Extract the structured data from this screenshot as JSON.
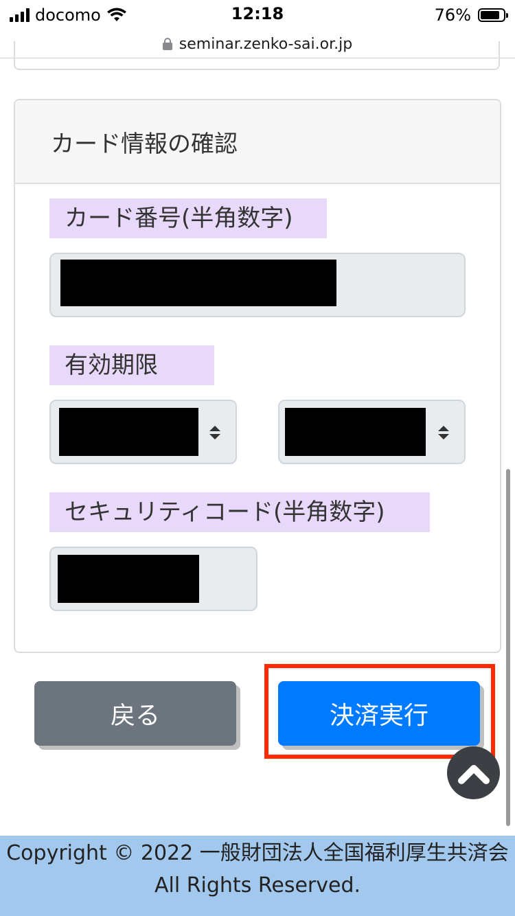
{
  "status_bar": {
    "carrier": "docomo",
    "time": "12:18",
    "battery_percent": "76%"
  },
  "url_bar": {
    "url": "seminar.zenko-sai.or.jp"
  },
  "card": {
    "title": "カード情報の確認",
    "card_number_label": "カード番号(半角数字)",
    "expiry_label": "有効期限",
    "security_code_label": "セキュリティコード(半角数字)"
  },
  "buttons": {
    "back_label": "戻る",
    "pay_label": "決済実行"
  },
  "footer": {
    "line1": "Copyright © 2022 一般財団法人全国福利厚生共済会",
    "line2": "All Rights Reserved."
  },
  "colors": {
    "label_bg": "#e8d9fb",
    "back_button": "#6c757d",
    "pay_button": "#007bff",
    "highlight": "#ff2a00",
    "footer_bg": "#a3c8ee"
  },
  "icons": {
    "signal": "cellular-signal-icon",
    "wifi": "wifi-icon",
    "battery": "battery-icon",
    "lock": "lock-icon",
    "select": "select-arrows-icon",
    "scroll_top": "chevron-up-icon"
  }
}
